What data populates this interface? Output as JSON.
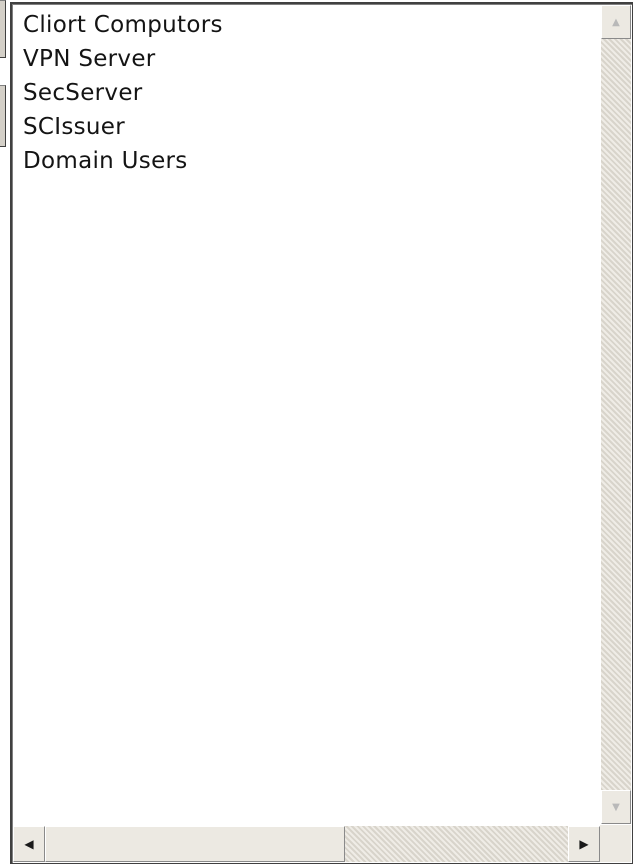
{
  "listbox": {
    "items": [
      {
        "label": "Cliort Computors"
      },
      {
        "label": "VPN Server"
      },
      {
        "label": "SecServer"
      },
      {
        "label": "SCIssuer"
      },
      {
        "label": "Domain Users"
      }
    ]
  },
  "scrollbars": {
    "up_glyph": "▲",
    "down_glyph": "▼",
    "left_glyph": "◀",
    "right_glyph": "▶"
  }
}
